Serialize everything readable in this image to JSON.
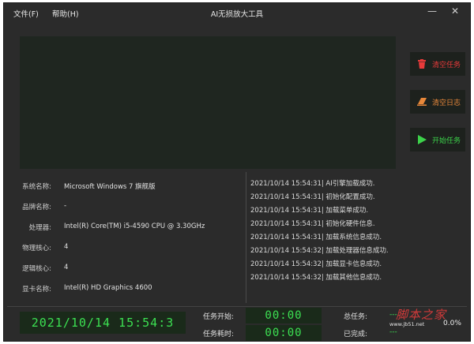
{
  "window": {
    "title": "AI无损放大工具"
  },
  "menu": [
    {
      "label": "文件(F)"
    },
    {
      "label": "帮助(H)"
    }
  ],
  "window_controls": {
    "minimize": "—",
    "close": "✕"
  },
  "buttons": {
    "clear_tasks": {
      "label": "清空任务",
      "icon": "trash-icon",
      "color": "#e83a3a"
    },
    "clear_log": {
      "label": "清空日志",
      "icon": "eraser-icon",
      "color": "#e8883a"
    },
    "start_task": {
      "label": "开始任务",
      "icon": "play-icon",
      "color": "#3cd24a"
    }
  },
  "system_info": [
    {
      "label": "系统名称:",
      "value": "Microsoft Windows 7 旗舰版"
    },
    {
      "label": "品牌名称:",
      "value": "-"
    },
    {
      "label": "处理器:",
      "value": "Intel(R) Core(TM) i5-4590 CPU @ 3.30GHz"
    },
    {
      "label": "物理核心:",
      "value": "4"
    },
    {
      "label": "逻辑核心:",
      "value": "4"
    },
    {
      "label": "显卡名称:",
      "value": "Intel(R) HD Graphics 4600"
    }
  ],
  "log": [
    "2021/10/14 15:54:31| AI引擎加载成功.",
    "2021/10/14 15:54:31| 初始化配置成功.",
    "2021/10/14 15:54:31| 加载菜单成功.",
    "2021/10/14 15:54:31| 初始化硬件信息.",
    "2021/10/14 15:54:31| 加载系统信息成功.",
    "2021/10/14 15:54:32| 加载处理器信息成功.",
    "2021/10/14 15:54:32| 加载显卡信息成功.",
    "2021/10/14 15:54:32| 加载其他信息成功."
  ],
  "status": {
    "clock": "2021/10/14 15:54:3",
    "task_start_label": "任务开始:",
    "task_start_value": "00:00",
    "task_elapsed_label": "任务耗时:",
    "task_elapsed_value": "00:00",
    "total_tasks_label": "总任务:",
    "total_tasks_value": "---",
    "completed_label": "已完成:",
    "completed_value": "---",
    "progress_text": "0.0%"
  },
  "watermark": {
    "text": "脚本之家",
    "url": "www.jb51.net"
  },
  "colors": {
    "background": "#2b2b2b",
    "digital_green": "#3ce052",
    "panel": "#1f2620"
  }
}
